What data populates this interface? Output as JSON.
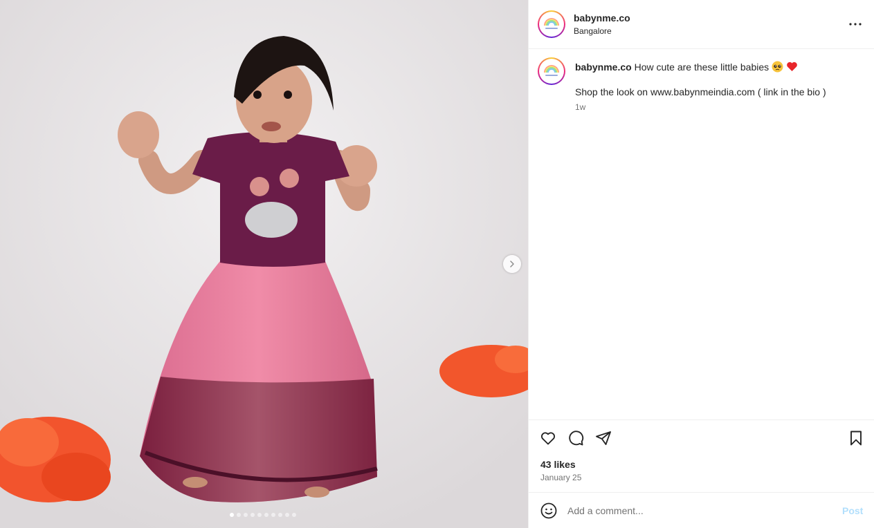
{
  "post": {
    "username": "babynme.co",
    "location": "Bangalore",
    "avatar_icon": "rainbow-logo",
    "caption_text": "How cute are these little babies",
    "caption_emoji_icons": [
      "pleading-face-icon",
      "red-heart-icon"
    ],
    "caption_line2": "Shop the look on www.babynmeindia.com ( link in the bio )",
    "time_ago": "1w",
    "likes": "43 likes",
    "date": "January 25"
  },
  "media": {
    "carousel_total": 10,
    "carousel_index": 1,
    "next_icon": "chevron-right-icon"
  },
  "actions": {
    "icons": [
      "heart-icon",
      "comment-icon",
      "share-icon",
      "bookmark-icon"
    ]
  },
  "comment": {
    "placeholder": "Add a comment...",
    "post_label": "Post",
    "emoji_icon": "smiley-icon"
  },
  "colors": {
    "text": "#262626",
    "secondary": "#737373",
    "post_disabled": "#b2dffc",
    "border": "#efefef"
  }
}
